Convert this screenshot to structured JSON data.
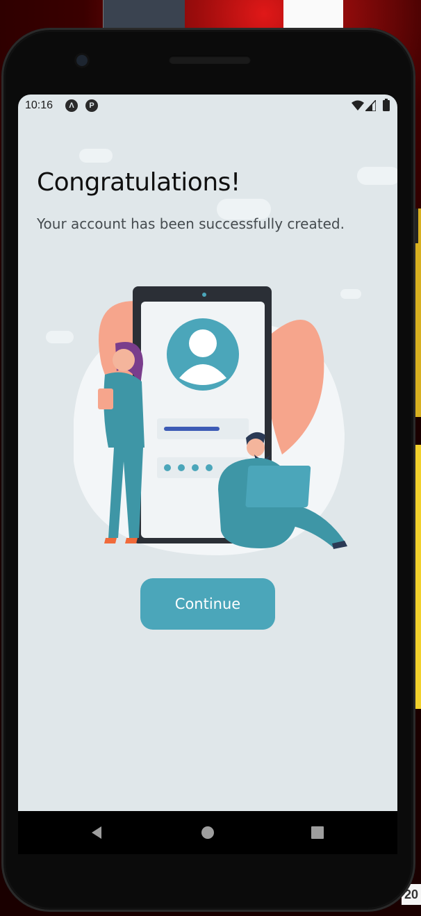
{
  "status_bar": {
    "time": "10:16"
  },
  "screen": {
    "title": "Congratulations!",
    "message": "Your account has been successfully created.",
    "continue_label": "Continue"
  },
  "colors": {
    "accent": "#4ba6ba",
    "background": "#e0e7ea",
    "leaf": "#f6a58c"
  },
  "icons": {
    "status": [
      "android-a-icon",
      "android-p-icon",
      "wifi-icon",
      "signal-icon",
      "battery-icon"
    ],
    "nav": [
      "back-icon",
      "home-icon",
      "recents-icon"
    ],
    "illustration": [
      "user-avatar-icon"
    ]
  }
}
